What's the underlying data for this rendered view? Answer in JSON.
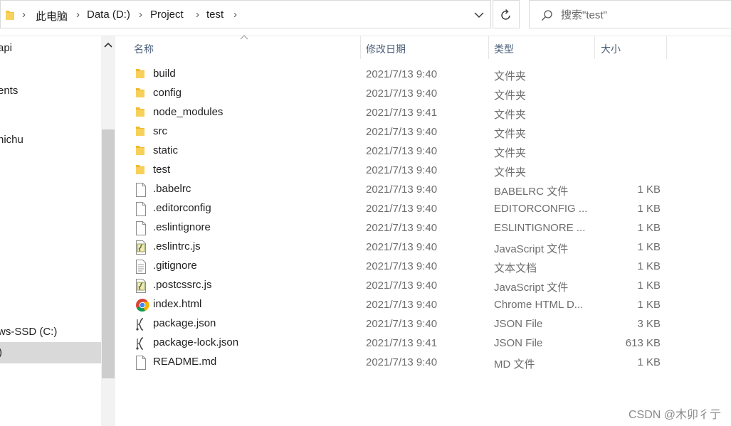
{
  "address_bar": {
    "breadcrumbs": [
      "此电脑",
      "Data (D:)",
      "Project",
      "test"
    ]
  },
  "search": {
    "placeholder": "搜索\"test\""
  },
  "nav": {
    "items": [
      "api",
      "ents",
      "nichu",
      "ws-SSD (C:)",
      ")"
    ],
    "selected_index": 4
  },
  "columns": {
    "name": "名称",
    "modified": "修改日期",
    "type": "类型",
    "size": "大小"
  },
  "files": [
    {
      "name": "build",
      "modified": "2021/7/13 9:40",
      "type": "文件夹",
      "size": "",
      "icon": "folder-icon"
    },
    {
      "name": "config",
      "modified": "2021/7/13 9:40",
      "type": "文件夹",
      "size": "",
      "icon": "folder-icon"
    },
    {
      "name": "node_modules",
      "modified": "2021/7/13 9:41",
      "type": "文件夹",
      "size": "",
      "icon": "folder-icon"
    },
    {
      "name": "src",
      "modified": "2021/7/13 9:40",
      "type": "文件夹",
      "size": "",
      "icon": "folder-icon"
    },
    {
      "name": "static",
      "modified": "2021/7/13 9:40",
      "type": "文件夹",
      "size": "",
      "icon": "folder-icon"
    },
    {
      "name": "test",
      "modified": "2021/7/13 9:40",
      "type": "文件夹",
      "size": "",
      "icon": "folder-icon"
    },
    {
      "name": ".babelrc",
      "modified": "2021/7/13 9:40",
      "type": "BABELRC 文件",
      "size": "1 KB",
      "icon": "blank-file-icon"
    },
    {
      "name": ".editorconfig",
      "modified": "2021/7/13 9:40",
      "type": "EDITORCONFIG ...",
      "size": "1 KB",
      "icon": "blank-file-icon"
    },
    {
      "name": ".eslintignore",
      "modified": "2021/7/13 9:40",
      "type": "ESLINTIGNORE ...",
      "size": "1 KB",
      "icon": "blank-file-icon"
    },
    {
      "name": ".eslintrc.js",
      "modified": "2021/7/13 9:40",
      "type": "JavaScript 文件",
      "size": "1 KB",
      "icon": "script-file-icon"
    },
    {
      "name": ".gitignore",
      "modified": "2021/7/13 9:40",
      "type": "文本文档",
      "size": "1 KB",
      "icon": "text-file-icon"
    },
    {
      "name": ".postcssrc.js",
      "modified": "2021/7/13 9:40",
      "type": "JavaScript 文件",
      "size": "1 KB",
      "icon": "script-file-icon"
    },
    {
      "name": "index.html",
      "modified": "2021/7/13 9:40",
      "type": "Chrome HTML D...",
      "size": "1 KB",
      "icon": "chrome-icon"
    },
    {
      "name": "package.json",
      "modified": "2021/7/13 9:40",
      "type": "JSON File",
      "size": "3 KB",
      "icon": "json-file-icon"
    },
    {
      "name": "package-lock.json",
      "modified": "2021/7/13 9:41",
      "type": "JSON File",
      "size": "613 KB",
      "icon": "json-file-icon"
    },
    {
      "name": "README.md",
      "modified": "2021/7/13 9:40",
      "type": "MD 文件",
      "size": "1 KB",
      "icon": "blank-file-icon"
    }
  ],
  "watermark": "CSDN @木卯彳亍",
  "colors": {
    "folder": "#f5c442",
    "header_text": "#4c607a",
    "secondary_text": "#6d6d6d",
    "selection": "#d9d9d9"
  }
}
